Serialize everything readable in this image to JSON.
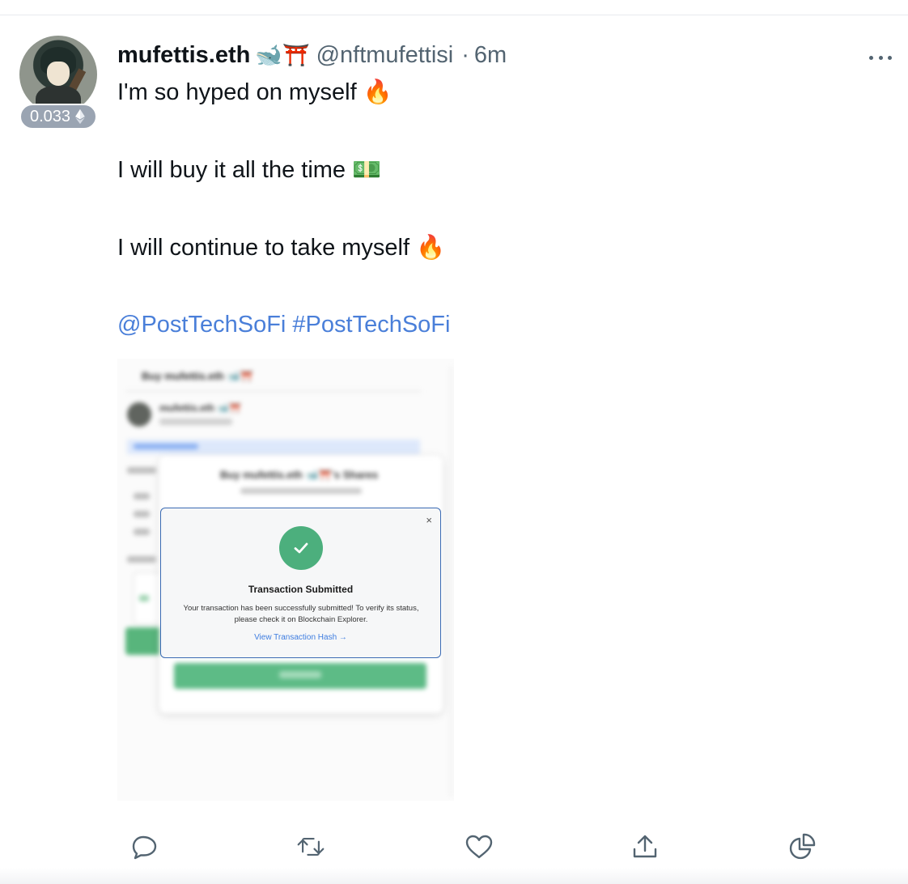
{
  "tweet": {
    "display_name": "mufettis.eth",
    "name_emojis": "🐋⛩️",
    "handle": "@nftmufettisi",
    "separator": "·",
    "time": "6m",
    "avatar_badge": "0.033",
    "lines": [
      "I'm so hyped on myself 🔥",
      "I will buy it all the time 💵",
      "I will continue to take myself 🔥"
    ],
    "mention": "@PostTechSoFi",
    "hashtag": "#PostTechSoFi"
  },
  "media": {
    "blurred_title": "Buy mufettis.eth 🐋⛩️",
    "blurred_name": "mufettis.eth 🐋⛩️",
    "blurred_card_title": "Buy mufettis.eth 🐋⛩️'s Shares",
    "dialog": {
      "close": "×",
      "title": "Transaction Submitted",
      "message": "Your transaction has been successfully submitted! To verify its status, please check it on Blockchain Explorer.",
      "link": "View Transaction Hash →"
    }
  },
  "colors": {
    "link": "#4a7fd9",
    "muted": "#536471",
    "success": "#4caf7d",
    "dialog_border": "#3a6ab3"
  },
  "actions": [
    "reply-icon",
    "retweet-icon",
    "like-icon",
    "share-icon",
    "analytics-icon"
  ]
}
